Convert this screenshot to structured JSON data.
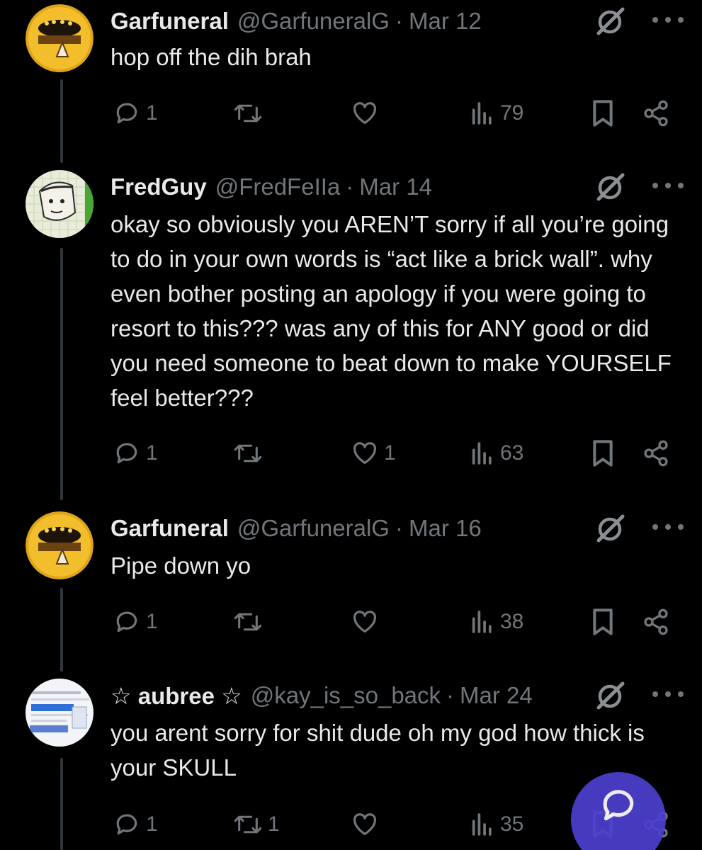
{
  "posts": [
    {
      "name": "Garfuneral",
      "handle": "@GarfuneralG",
      "separator": "·",
      "date": "Mar 12",
      "text": "hop off the dih brah",
      "replies": "1",
      "reposts": "",
      "likes": "",
      "views": "79",
      "avatar": "garfield-helmet-avatar"
    },
    {
      "name": "FredGuy",
      "handle": "@FredFeIIa",
      "separator": "·",
      "date": "Mar 14",
      "text": "okay so obviously you AREN’T sorry if all you’re going to do in your own words is “act like a brick wall”. why even bother posting an apology if you were going to resort to this??? was any of this for ANY good or did you need someone to beat down to make YOURSELF feel better???",
      "replies": "1",
      "reposts": "",
      "likes": "1",
      "views": "63",
      "avatar": "sketch-drawing-avatar"
    },
    {
      "name": "Garfuneral",
      "handle": "@GarfuneralG",
      "separator": "·",
      "date": "Mar 16",
      "text": "Pipe down yo",
      "replies": "1",
      "reposts": "",
      "likes": "",
      "views": "38",
      "avatar": "garfield-helmet-avatar"
    },
    {
      "name": "☆ aubree ☆",
      "handle": "@kay_is_so_back",
      "separator": "·",
      "date": "Mar 24",
      "text": "you arent sorry for shit dude oh my god how thick is your SKULL",
      "replies": "1",
      "reposts": "1",
      "likes": "",
      "views": "35",
      "avatar": "screenshot-avatar"
    }
  ],
  "icons": {
    "reply": "reply-icon",
    "repost": "repost-icon",
    "like": "heart-icon",
    "views": "views-icon",
    "bookmark": "bookmark-icon",
    "share": "share-icon",
    "grok": "grok-icon",
    "more": "more-icon",
    "compose": "compose-reply-icon"
  },
  "colors": {
    "background": "#000000",
    "text": "#e7e9ea",
    "muted": "#71767b",
    "fab": "#4d3fd0"
  }
}
